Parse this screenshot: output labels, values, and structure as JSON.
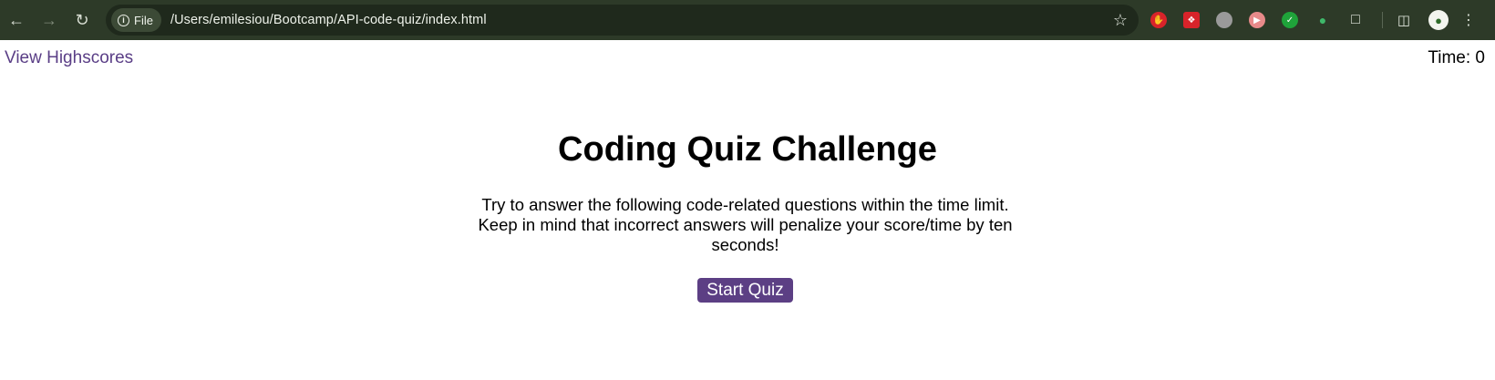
{
  "browser": {
    "url_chip": "File",
    "url": "/Users/emilesiou/Bootcamp/API-code-quiz/index.html",
    "extensions": [
      {
        "name": "stop-hand-extension-icon",
        "color": "#d8232a"
      },
      {
        "name": "red-square-extension-icon",
        "color": "#d8232a"
      },
      {
        "name": "gray-round-extension-icon",
        "color": "#9a9a9a"
      },
      {
        "name": "pink-arrow-extension-icon",
        "color": "#e88a8a"
      },
      {
        "name": "green-check-extension-icon",
        "color": "#1fa33a"
      },
      {
        "name": "green-leaf-extension-icon",
        "color": "#3fb86a"
      }
    ]
  },
  "header": {
    "highscores_link": "View Highscores",
    "timer_text": "Time: 0"
  },
  "main": {
    "title": "Coding Quiz Challenge",
    "description": "Try to answer the following code-related questions within the time limit. Keep in mind that incorrect answers will penalize your score/time by ten seconds!",
    "start_button": "Start Quiz"
  },
  "colors": {
    "accent": "#5c3f84",
    "link": "#5a3e86",
    "toolbar": "#2d3a28"
  }
}
